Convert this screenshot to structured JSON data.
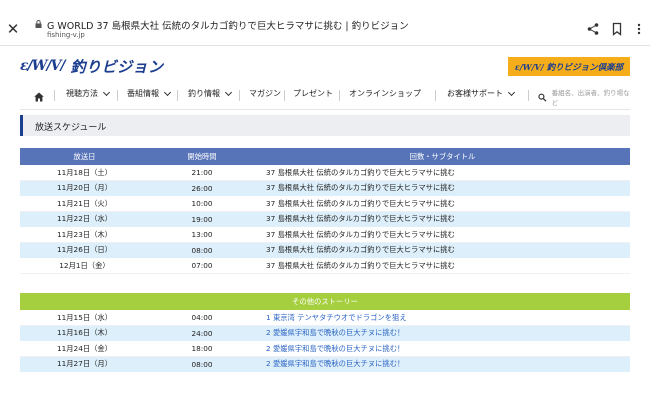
{
  "browser": {
    "title": "G WORLD 37 島根県大社 伝統のタルカゴ釣りで巨大ヒラマサに挑む | 釣りビジョン",
    "url": "fishing-v.jp"
  },
  "header": {
    "logo_mark": "ɛ/W/V/",
    "logo_text": "釣りビジョン",
    "club_mark": "ɛ/W/V/",
    "club_text": "釣りビジョン倶楽部"
  },
  "nav": {
    "items": [
      "視聴方法",
      "番組情報",
      "釣り情報",
      "マガジン",
      "プレゼント",
      "オンラインショップ",
      "お客様サポート"
    ],
    "search_placeholder": "番組名、出演者、釣り場など"
  },
  "section": {
    "title": "放送スケジュール"
  },
  "schedule": {
    "headers": [
      "放送日",
      "開始時間",
      "回数・サブタイトル"
    ],
    "rows": [
      [
        "11月18日（土）",
        "21:00",
        "37 島根県大社 伝統のタルカゴ釣りで巨大ヒラマサに挑む"
      ],
      [
        "11月20日（月）",
        "26:00",
        "37 島根県大社 伝統のタルカゴ釣りで巨大ヒラマサに挑む"
      ],
      [
        "11月21日（火）",
        "10:00",
        "37 島根県大社 伝統のタルカゴ釣りで巨大ヒラマサに挑む"
      ],
      [
        "11月22日（水）",
        "19:00",
        "37 島根県大社 伝統のタルカゴ釣りで巨大ヒラマサに挑む"
      ],
      [
        "11月23日（木）",
        "13:00",
        "37 島根県大社 伝統のタルカゴ釣りで巨大ヒラマサに挑む"
      ],
      [
        "11月26日（日）",
        "08:00",
        "37 島根県大社 伝統のタルカゴ釣りで巨大ヒラマサに挑む"
      ],
      [
        "12月1日（金）",
        "07:00",
        "37 島根県大社 伝統のタルカゴ釣りで巨大ヒラマサに挑む"
      ]
    ]
  },
  "other": {
    "header": "その他のストーリー",
    "rows": [
      [
        "11月15日（水）",
        "04:00",
        "1 東京湾 テンヤタチウオでドラゴンを狙え"
      ],
      [
        "11月16日（木）",
        "24:00",
        "2 愛媛県宇和島で晩秋の巨大チヌに挑む！"
      ],
      [
        "11月24日（金）",
        "18:00",
        "2 愛媛県宇和島で晩秋の巨大チヌに挑む！"
      ],
      [
        "11月27日（月）",
        "08:00",
        "2 愛媛県宇和島で晩秋の巨大チヌに挑む！"
      ]
    ]
  },
  "colors": {
    "brand_blue": "#1c3e8f",
    "schedule_header": "#5874b8",
    "other_header": "#a6cf40",
    "row_alt": "#ddeffa",
    "club_bg": "#f6ad1a",
    "link": "#2a63c4"
  },
  "icons": [
    "close-icon",
    "lock-icon",
    "share-icon",
    "bookmark-icon",
    "more-vert-icon",
    "home-icon",
    "chevron-down-icon",
    "search-icon"
  ]
}
